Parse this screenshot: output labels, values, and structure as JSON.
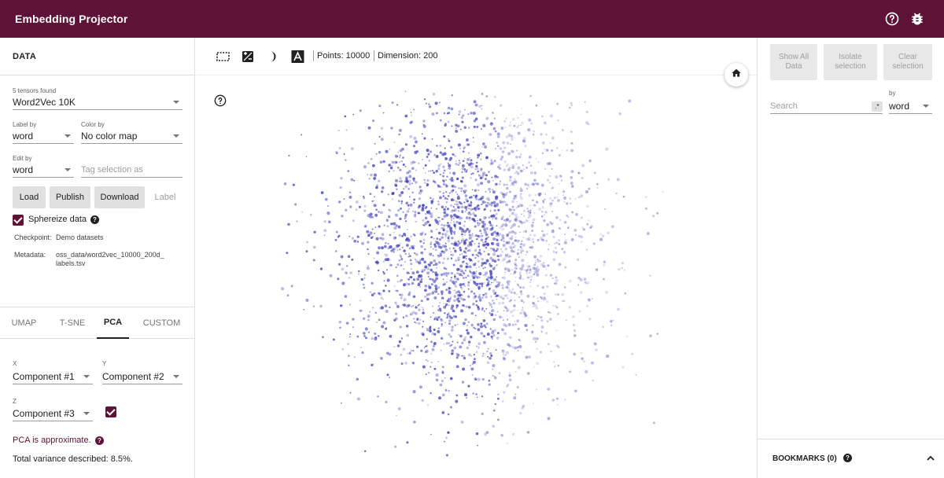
{
  "app": {
    "title": "Embedding Projector"
  },
  "header_icons": [
    "help-icon",
    "bug-icon"
  ],
  "colors": {
    "accent": "#5e1236",
    "points": "#3f3fb5"
  },
  "data_panel": {
    "title": "DATA",
    "tensors_label": "5 tensors found",
    "tensor_value": "Word2Vec 10K",
    "label_by_label": "Label by",
    "label_by_value": "word",
    "color_by_label": "Color by",
    "color_by_value": "No color map",
    "edit_by_label": "Edit by",
    "edit_by_value": "word",
    "tag_placeholder": "Tag selection as",
    "buttons": {
      "load": "Load",
      "publish": "Publish",
      "download": "Download",
      "label": "Label"
    },
    "sphereize_label": "Sphereize data",
    "checkpoint_key": "Checkpoint:",
    "checkpoint_value": "Demo datasets",
    "metadata_key": "Metadata:",
    "metadata_line1": "oss_data/word2vec_10000_200d_",
    "metadata_line2": "labels.tsv"
  },
  "projection_tabs": [
    {
      "label": "UMAP"
    },
    {
      "label": "T-SNE"
    },
    {
      "label": "PCA",
      "active": true
    },
    {
      "label": "CUSTOM"
    }
  ],
  "pca": {
    "x_label": "X",
    "x_value": "Component #1",
    "y_label": "Y",
    "y_value": "Component #2",
    "z_label": "Z",
    "z_value": "Component #3",
    "approx_text": "PCA is approximate.",
    "variance_text": "Total variance described: 8.5%."
  },
  "toolbar": {
    "icons": [
      "select-rectangle-icon",
      "night-mode-icon",
      "contrast-icon",
      "label-icon"
    ],
    "points_text": "Points: 10000",
    "dimension_text": "Dimension: 200"
  },
  "inspector": {
    "show_all": "Show All Data",
    "isolate": "Isolate selection",
    "clear": "Clear selection",
    "search_placeholder": "Search",
    "regex_label": ".*",
    "by_label": "by",
    "by_value": "word",
    "bookmarks_label": "BOOKMARKS (0)"
  }
}
